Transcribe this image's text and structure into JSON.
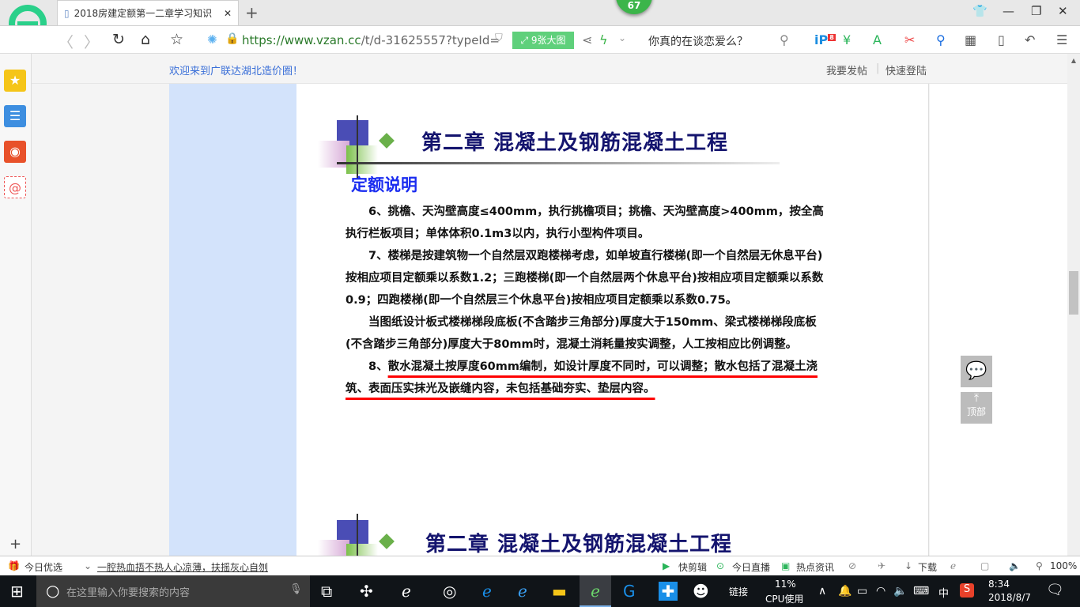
{
  "browser": {
    "tab_title": "2018房建定额第一二章学习知识",
    "notification_count": "67",
    "url_host": "https://www.vzan.cc",
    "url_path": "/t/d-31625557?typeId=",
    "big_image_button": "9张大图",
    "search_text": "你真的在谈恋爱么？",
    "badge_count": "8"
  },
  "page": {
    "welcome": "欢迎来到广联达湖北造价圈！",
    "post_link": "我要发帖",
    "login_link": "快速登陆",
    "chapter_title": "第二章  混凝土及钢筋混凝土工程",
    "subtitle": "定额说明",
    "paragraphs": [
      "6、挑檐、天沟壁高度≤400mm，执行挑檐项目；挑檐、天沟壁高度>400mm，按全高执行栏板项目；单体体积0.1m3以内，执行小型构件项目。",
      "7、楼梯是按建筑物一个自然层双跑楼梯考虑，如单坡直行楼梯(即一个自然层无休息平台)按相应项目定额乘以系数1.2；三跑楼梯(即一个自然层两个休息平台)按相应项目定额乘以系数0.9；四跑楼梯(即一个自然层三个休息平台)按相应项目定额乘以系数0.75。",
      "当图纸设计板式楼梯梯段底板(不含踏步三角部分)厚度大于150mm、梁式楼梯梯段底板(不含踏步三角部分)厚度大于80mm时，混凝土消耗量按实调整，人工按相应比例调整。"
    ],
    "p8_prefix": "8、",
    "p8_underlined": "散水混凝土按厚度60mm编制，如设计厚度不同时，可以调整；散水包括了混凝土浇筑、表面压实抹光及嵌缝内容，未包括基础夯实、垫层内容。",
    "chapter_title_2": "第二章  混凝土及钢筋混凝土工程",
    "top_button": "顶部"
  },
  "statusbar": {
    "today_pick": "今日优选",
    "headline": "一腔热血捂不热人心凉薄，扶摇灰心自刎",
    "quick_edit": "快剪辑",
    "live": "今日直播",
    "news": "热点资讯",
    "download": "下载",
    "zoom": "100%"
  },
  "taskbar": {
    "search_placeholder": "在这里输入你要搜索的内容",
    "link_label": "链接",
    "cpu_percent": "11%",
    "cpu_label": "CPU使用",
    "ime": "中",
    "time": "8:34",
    "date": "2018/8/7"
  },
  "colors": {
    "accent_green": "#3cb54a",
    "title_navy": "#14146e",
    "subtitle_blue": "#1a2cf0",
    "underline_red": "#ff0000",
    "column_blue": "#d3e3fb"
  }
}
